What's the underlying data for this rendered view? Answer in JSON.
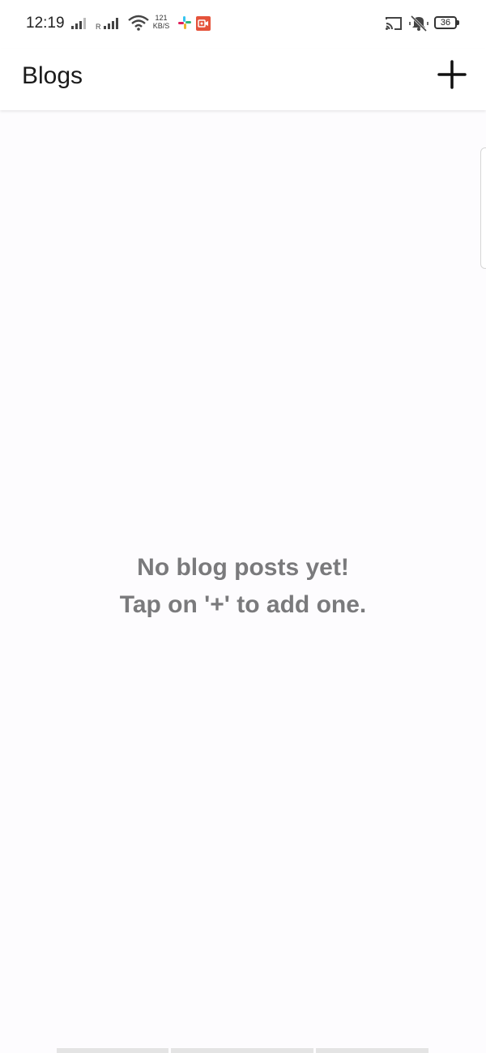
{
  "status_bar": {
    "time": "12:19",
    "network_label": "R",
    "speed_value": "121",
    "speed_unit": "KB/S",
    "battery": "36"
  },
  "app_bar": {
    "title": "Blogs",
    "add_icon": "plus-icon"
  },
  "empty_state": {
    "line1": "No blog posts yet!",
    "line2": "Tap on '+' to add one."
  },
  "icons": {
    "signal": "signal-icon",
    "wifi": "wifi-icon",
    "slack": "slack-icon",
    "recording": "screen-record-icon",
    "cast": "cast-icon",
    "mute": "vibrate-mute-icon",
    "battery": "battery-icon"
  },
  "colors": {
    "accent_record": "#e5533b",
    "empty_text": "#7a7a7c",
    "background": "#fdfcfe"
  }
}
